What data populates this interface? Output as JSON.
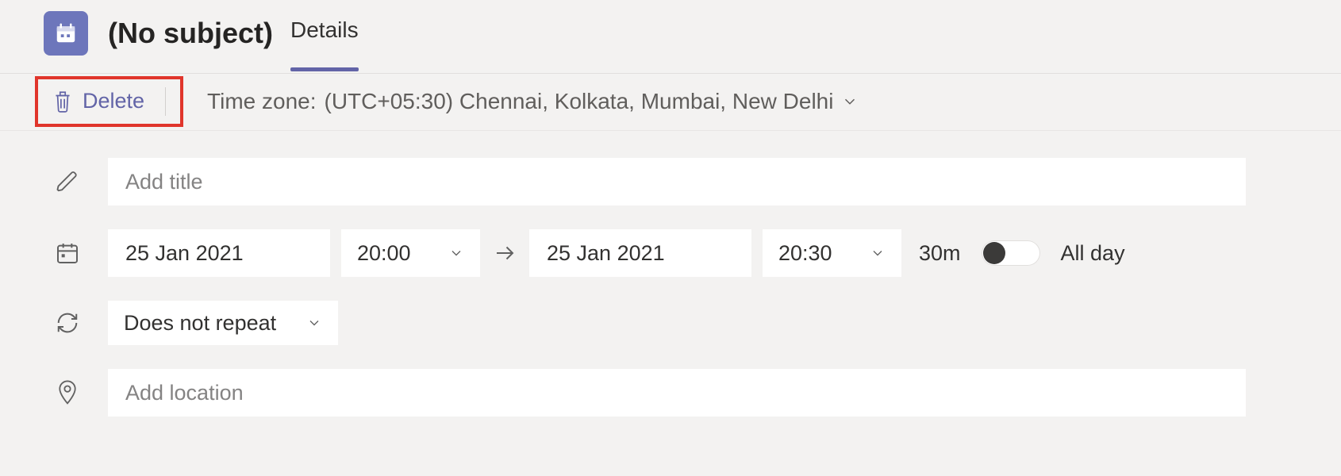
{
  "header": {
    "title": "(No subject)",
    "tab_details": "Details"
  },
  "toolbar": {
    "delete_label": "Delete",
    "timezone_label": "Time zone:",
    "timezone_value": "(UTC+05:30) Chennai, Kolkata, Mumbai, New Delhi"
  },
  "form": {
    "title_placeholder": "Add title",
    "title_value": "",
    "start_date": "25 Jan 2021",
    "start_time": "20:00",
    "end_date": "25 Jan 2021",
    "end_time": "20:30",
    "duration": "30m",
    "all_day_label": "All day",
    "repeat": "Does not repeat",
    "location_placeholder": "Add location",
    "location_value": ""
  }
}
